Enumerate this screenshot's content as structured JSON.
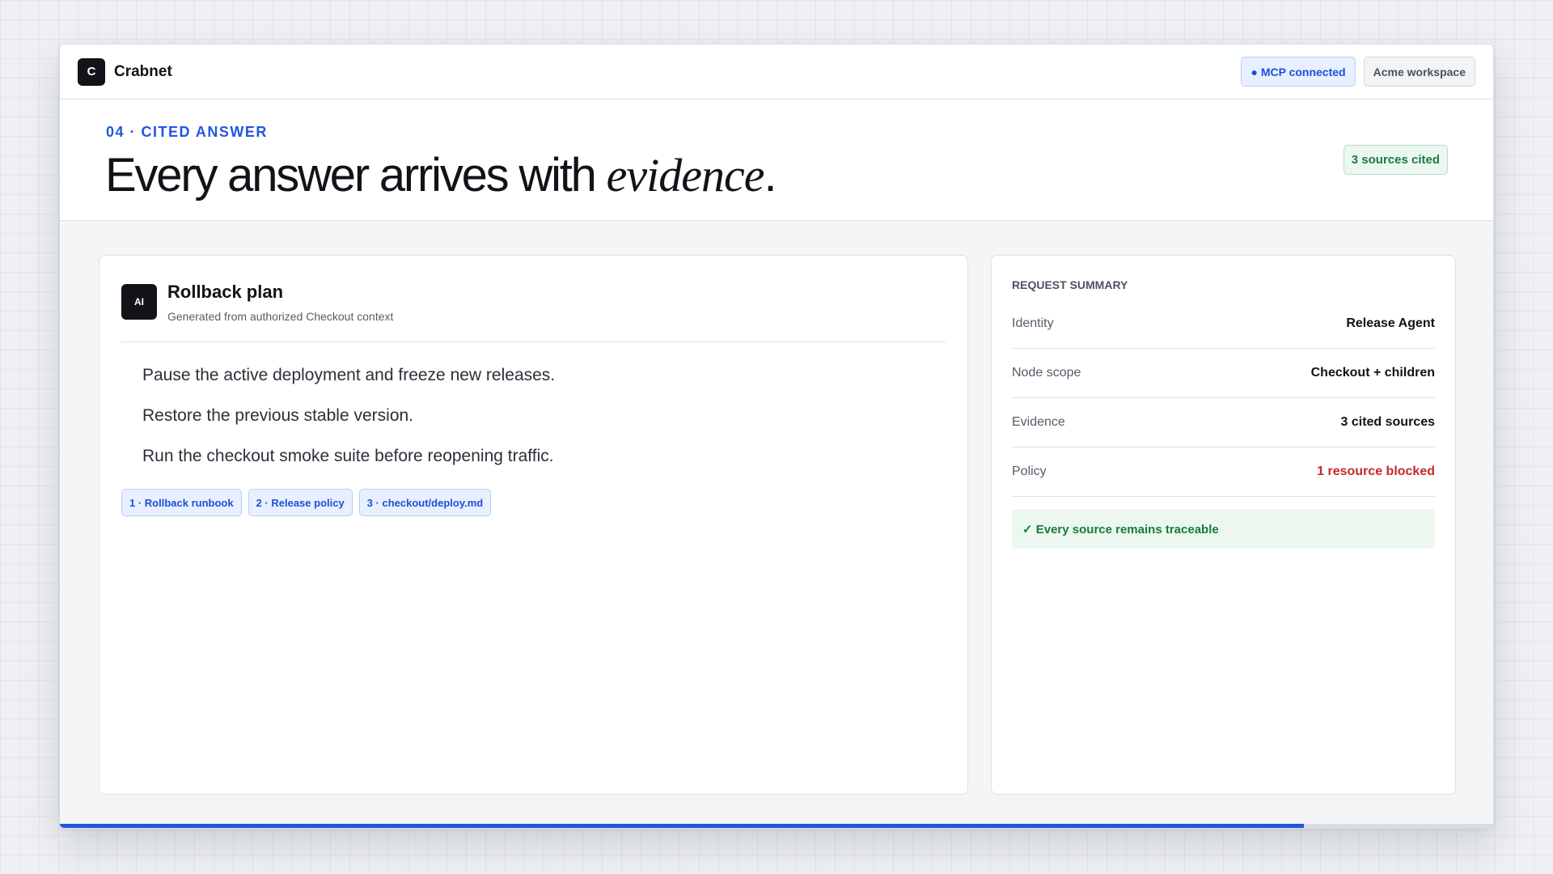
{
  "app": {
    "logo_letter": "C",
    "name": "Crabnet"
  },
  "topbar": {
    "connection_status": "● MCP connected",
    "workspace": "Acme workspace"
  },
  "hero": {
    "eyebrow": "04 · CITED ANSWER",
    "headline_plain": "Every answer arrives with ",
    "headline_emphasis": "evidence",
    "headline_end": ".",
    "sources_badge": "3 sources cited"
  },
  "answer": {
    "avatar_label": "AI",
    "title": "Rollback plan",
    "subtitle": "Generated from authorized Checkout context",
    "steps": [
      "Pause the active deployment and freeze new releases.",
      "Restore the previous stable version.",
      "Run the checkout smoke suite before reopening traffic."
    ],
    "citations": [
      "1 · Rollback runbook",
      "2 · Release policy",
      "3 · checkout/deploy.md"
    ]
  },
  "summary": {
    "heading": "REQUEST SUMMARY",
    "rows": [
      {
        "label": "Identity",
        "value": "Release Agent"
      },
      {
        "label": "Node scope",
        "value": "Checkout + children"
      },
      {
        "label": "Evidence",
        "value": "3 cited sources"
      },
      {
        "label": "Policy",
        "value": "1 resource blocked"
      }
    ],
    "traceable_note": "✓ Every source remains traceable"
  },
  "progress": {
    "fraction": 0.868
  },
  "colors": {
    "accent": "#1f57e0",
    "success": "#1b7a3c",
    "danger": "#c62828",
    "ink": "#111318"
  }
}
